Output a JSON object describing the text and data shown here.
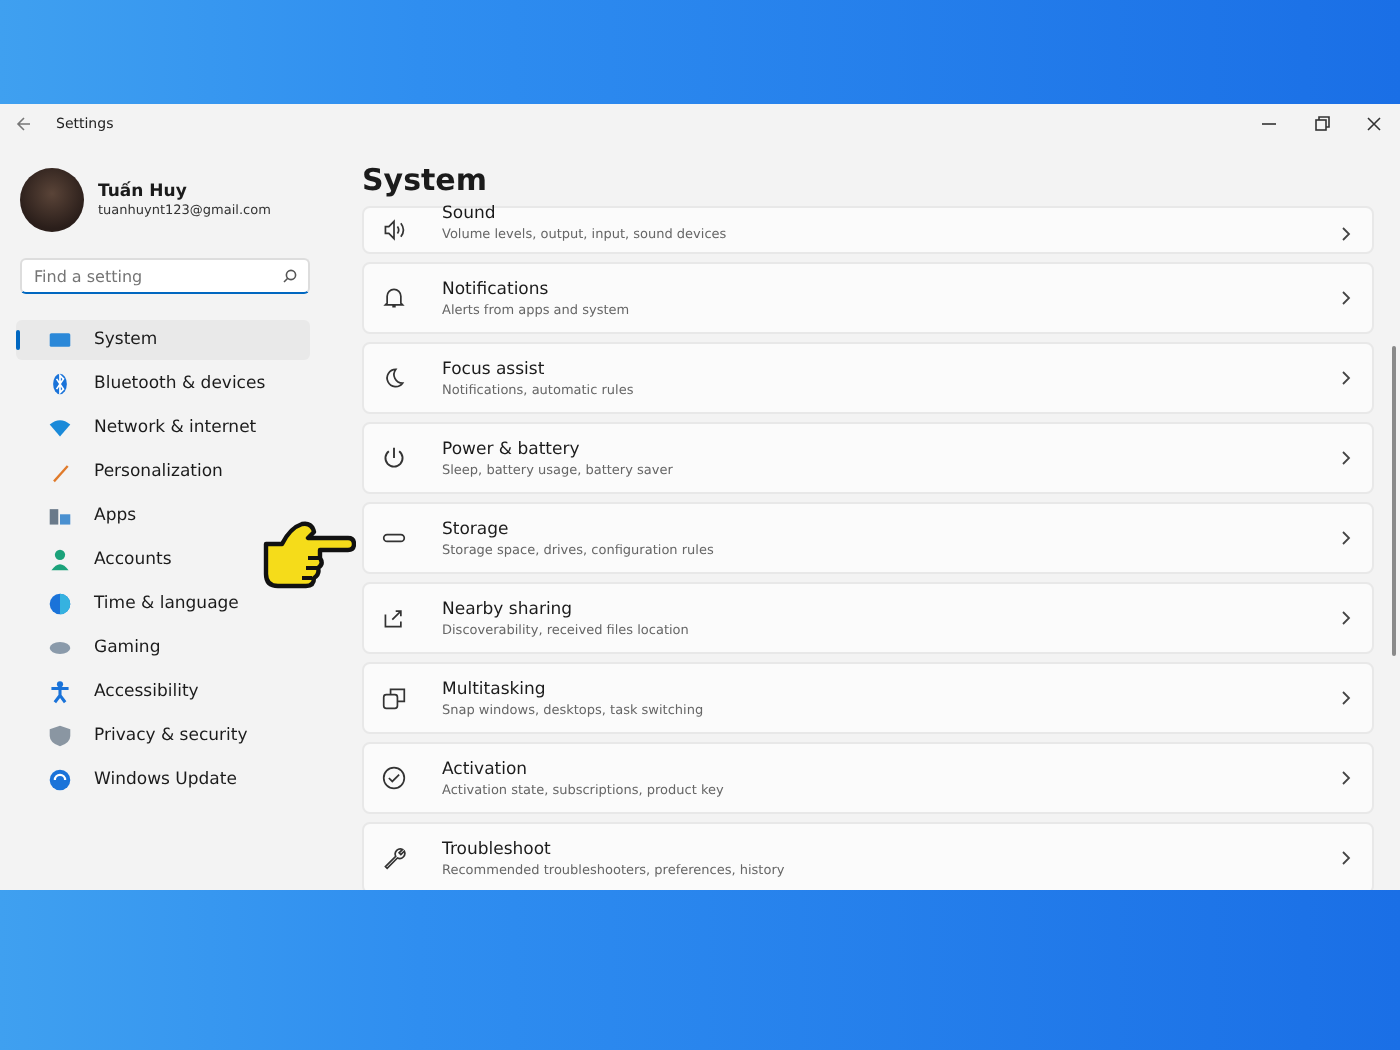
{
  "window": {
    "title": "Settings"
  },
  "profile": {
    "name": "Tuấn Huy",
    "email": "tuanhuynt123@gmail.com"
  },
  "search": {
    "placeholder": "Find a setting"
  },
  "nav": [
    {
      "label": "System",
      "selected": true
    },
    {
      "label": "Bluetooth & devices",
      "selected": false
    },
    {
      "label": "Network & internet",
      "selected": false
    },
    {
      "label": "Personalization",
      "selected": false
    },
    {
      "label": "Apps",
      "selected": false
    },
    {
      "label": "Accounts",
      "selected": false
    },
    {
      "label": "Time & language",
      "selected": false
    },
    {
      "label": "Gaming",
      "selected": false
    },
    {
      "label": "Accessibility",
      "selected": false
    },
    {
      "label": "Privacy & security",
      "selected": false
    },
    {
      "label": "Windows Update",
      "selected": false
    }
  ],
  "page": {
    "title": "System"
  },
  "cards": [
    {
      "title": "Sound",
      "description": "Volume levels, output, input, sound devices"
    },
    {
      "title": "Notifications",
      "description": "Alerts from apps and system"
    },
    {
      "title": "Focus assist",
      "description": "Notifications, automatic rules"
    },
    {
      "title": "Power & battery",
      "description": "Sleep, battery usage, battery saver"
    },
    {
      "title": "Storage",
      "description": "Storage space, drives, configuration rules"
    },
    {
      "title": "Nearby sharing",
      "description": "Discoverability, received files location"
    },
    {
      "title": "Multitasking",
      "description": "Snap windows, desktops, task switching"
    },
    {
      "title": "Activation",
      "description": "Activation state, subscriptions, product key"
    },
    {
      "title": "Troubleshoot",
      "description": "Recommended troubleshooters, preferences, history"
    }
  ]
}
